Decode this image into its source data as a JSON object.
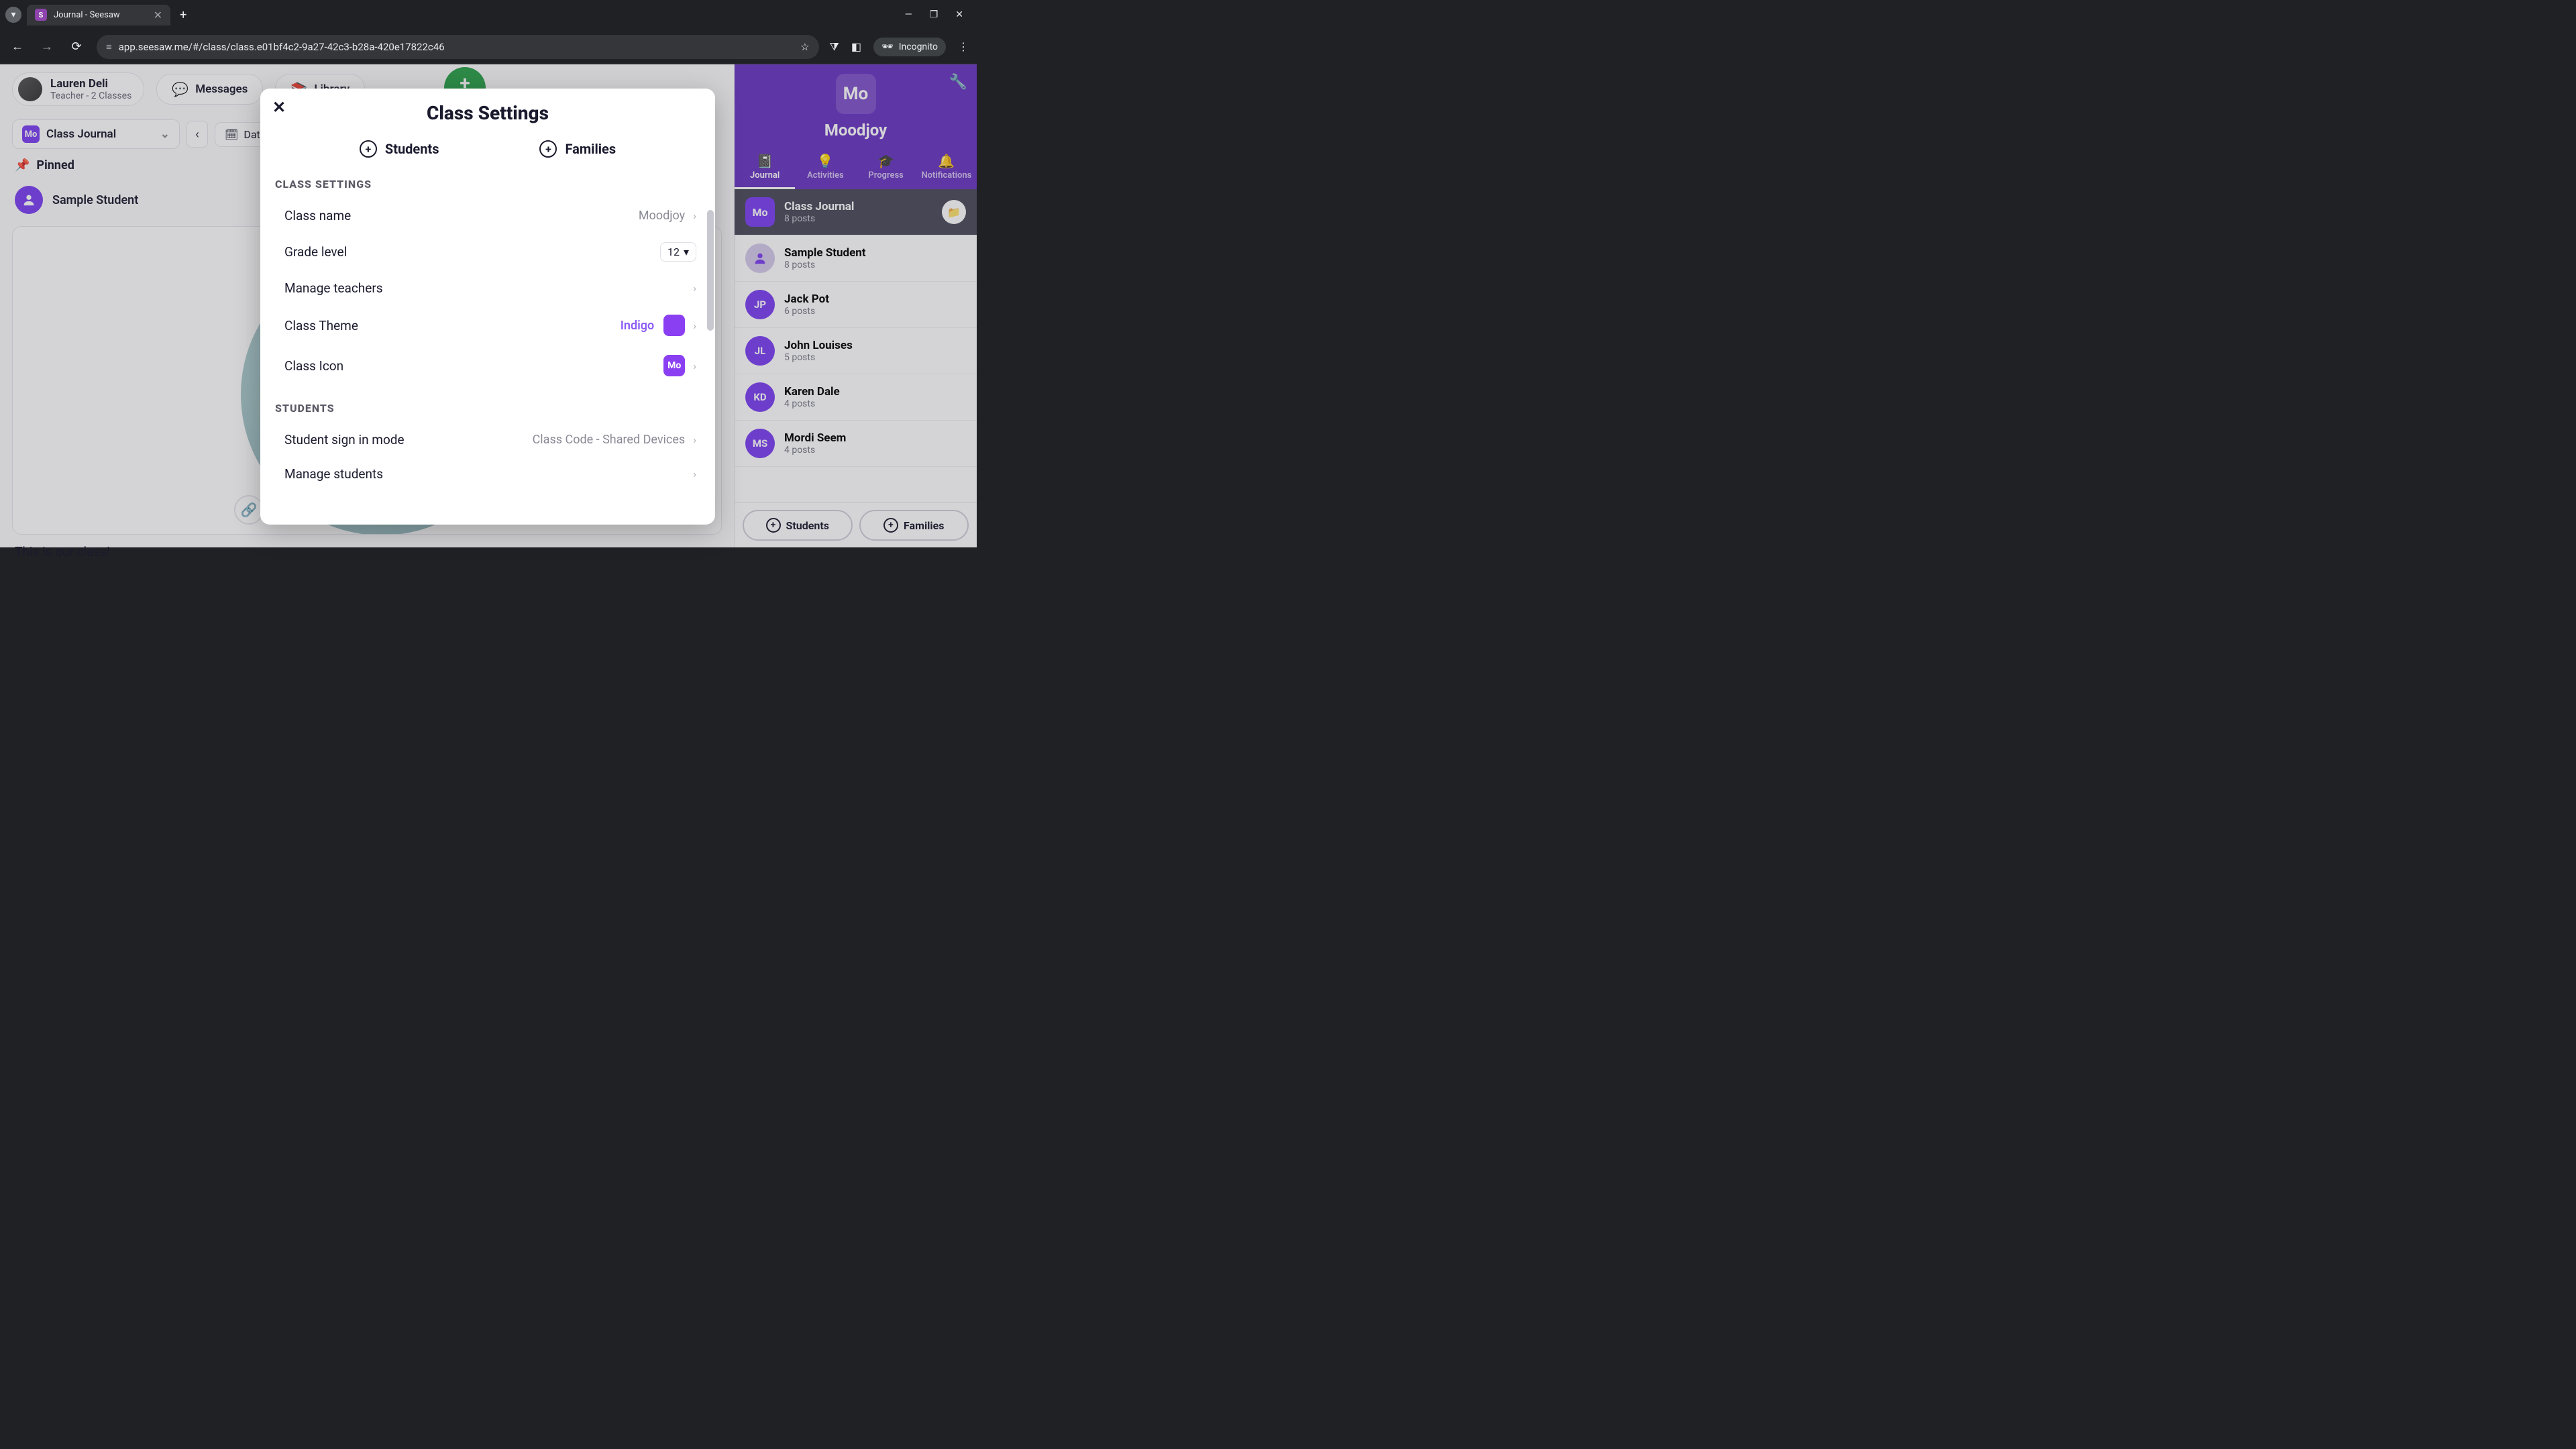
{
  "browser": {
    "tab_title": "Journal - Seesaw",
    "url": "app.seesaw.me/#/class/class.e01bf4c2-9a27-42c3-b28a-420e17822c46",
    "incognito_label": "Incognito"
  },
  "header": {
    "user_name": "Lauren Deli",
    "user_role": "Teacher - 2 Classes",
    "messages_label": "Messages",
    "library_label": "Library",
    "add_label": "Add"
  },
  "journal": {
    "selector_label": "Class Journal",
    "dates_label": "Dates",
    "pinned_label": "Pinned",
    "sample_student": "Sample Student",
    "caption": "This is our class!"
  },
  "right_panel": {
    "class_badge": "Mo",
    "class_name": "Moodjoy",
    "tabs": {
      "journal": "Journal",
      "activities": "Activities",
      "progress": "Progress",
      "notifications": "Notifications"
    },
    "items": [
      {
        "badge": "Mo",
        "name": "Class Journal",
        "sub": "8 posts"
      },
      {
        "badge": "",
        "name": "Sample Student",
        "sub": "8 posts"
      },
      {
        "badge": "JP",
        "name": "Jack Pot",
        "sub": "6 posts"
      },
      {
        "badge": "JL",
        "name": "John Louises",
        "sub": "5 posts"
      },
      {
        "badge": "KD",
        "name": "Karen Dale",
        "sub": "4 posts"
      },
      {
        "badge": "MS",
        "name": "Mordi Seem",
        "sub": "4 posts"
      }
    ],
    "footer": {
      "students": "Students",
      "families": "Families"
    }
  },
  "modal": {
    "title": "Class Settings",
    "tabs": {
      "students": "Students",
      "families": "Families"
    },
    "section_class": "CLASS SETTINGS",
    "section_students": "STUDENTS",
    "rows": {
      "class_name_label": "Class name",
      "class_name_value": "Moodjoy",
      "grade_label": "Grade level",
      "grade_value": "12",
      "manage_teachers": "Manage teachers",
      "theme_label": "Class Theme",
      "theme_value": "Indigo",
      "icon_label": "Class Icon",
      "icon_value": "Mo",
      "signin_label": "Student sign in mode",
      "signin_value": "Class Code - Shared Devices",
      "manage_students": "Manage students"
    }
  }
}
